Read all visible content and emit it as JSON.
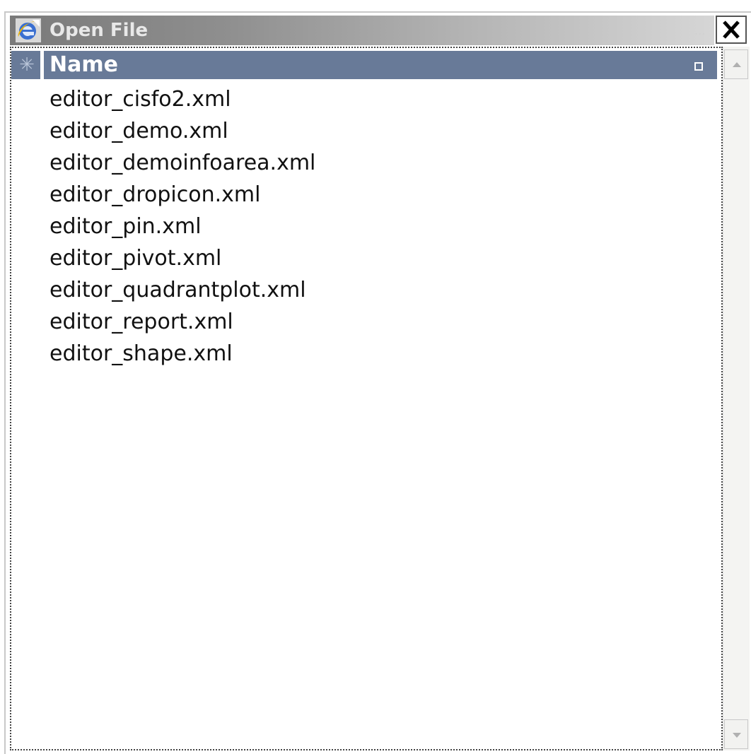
{
  "window": {
    "title": "Open File",
    "title_dots": "...",
    "close_label": "Close",
    "app_icon": "internet-explorer-icon"
  },
  "table": {
    "column_header": "Name",
    "row_selector_glyph": "✳"
  },
  "files": [
    "editor_cisfo2.xml",
    "editor_demo.xml",
    "editor_demoinfoarea.xml",
    "editor_dropicon.xml",
    "editor_pin.xml",
    "editor_pivot.xml",
    "editor_quadrantplot.xml",
    "editor_report.xml",
    "editor_shape.xml"
  ],
  "colors": {
    "header_bg": "#687a98",
    "titlebar_start": "#7a7a7a",
    "titlebar_end": "#d6d6d6"
  },
  "scrollbar": {
    "up_icon": "scroll-up-arrow-icon",
    "down_icon": "scroll-down-arrow-icon"
  }
}
